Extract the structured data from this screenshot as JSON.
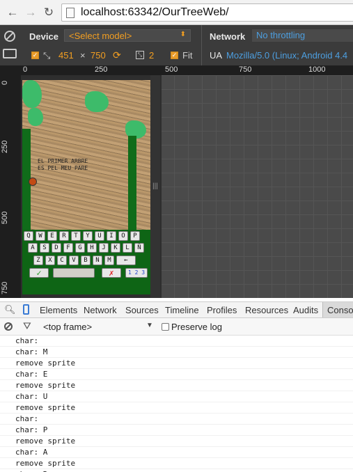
{
  "browser": {
    "url": "localhost:63342/OurTreeWeb/",
    "back_icon": "back-arrow-icon",
    "forward_icon": "forward-arrow-icon",
    "reload_icon": "reload-icon"
  },
  "device_toolbar": {
    "device_label": "Device",
    "model_placeholder": "<Select model>",
    "width": "451",
    "times": "×",
    "height": "750",
    "device_pixel_ratio": "2",
    "fit_label": "Fit",
    "network_label": "Network",
    "throttling": "No throttling",
    "ua_label": "UA",
    "ua_value": "Mozilla/5.0 (Linux; Android 4.4"
  },
  "rulers": {
    "h_ticks": [
      "0",
      "250",
      "500",
      "750",
      "1000"
    ],
    "v_ticks": [
      "0",
      "250",
      "500",
      "750"
    ]
  },
  "game": {
    "line1": "EL PRIMER ARBRE",
    "line2": "ES PEL MEU PARE",
    "keyboard_rows": [
      [
        "Q",
        "W",
        "E",
        "R",
        "T",
        "Y",
        "U",
        "I",
        "O",
        "P"
      ],
      [
        "A",
        "S",
        "D",
        "F",
        "G",
        "H",
        "J",
        "K",
        "L",
        "Ñ"
      ],
      [
        "Z",
        "X",
        "C",
        "V",
        "B",
        "N",
        "M",
        "←"
      ]
    ],
    "accept_symbol": "✓",
    "cancel_symbol": "✗",
    "numbers_key": "1 2 3"
  },
  "devtools": {
    "tabs": [
      "Elements",
      "Network",
      "Sources",
      "Timeline",
      "Profiles",
      "Resources",
      "Audits",
      "Conso"
    ],
    "frame_selector": "<top frame>",
    "preserve_log_label": "Preserve log"
  },
  "console_messages": [
    "char:",
    "char: M",
    "remove sprite",
    "char: E",
    "remove sprite",
    "char: U",
    "remove sprite",
    "char:",
    "char: P",
    "remove sprite",
    "char: A",
    "remove sprite",
    "char: R"
  ],
  "colors": {
    "accent_orange": "#f29e21",
    "accent_blue": "#4d9fe0",
    "game_green": "#106c1a",
    "devtools_dark": "#3b3b3b"
  }
}
